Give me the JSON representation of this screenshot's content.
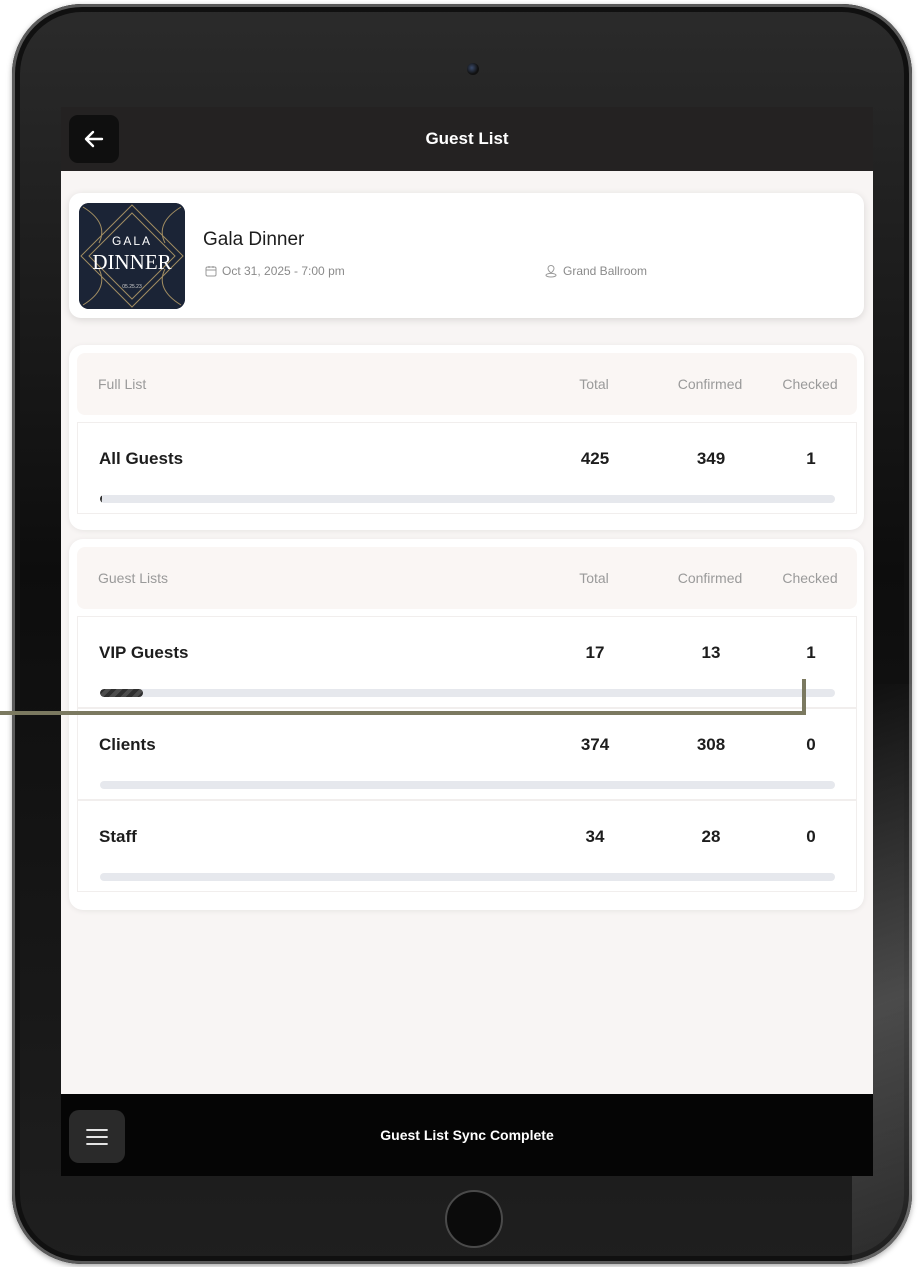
{
  "header": {
    "title": "Guest List"
  },
  "event": {
    "name": "Gala Dinner",
    "date": "Oct 31, 2025 - 7:00 pm",
    "venue": "Grand Ballroom",
    "thumb": {
      "line1": "GALA",
      "line2": "DINNER",
      "line3": "05.25.23"
    }
  },
  "full_list": {
    "header": {
      "name": "Full List",
      "total": "Total",
      "confirmed": "Confirmed",
      "checked": "Checked"
    },
    "rows": [
      {
        "name": "All Guests",
        "total": "425",
        "confirmed": "349",
        "checked": "1",
        "progress": 0.002
      }
    ]
  },
  "guest_lists": {
    "header": {
      "name": "Guest Lists",
      "total": "Total",
      "confirmed": "Confirmed",
      "checked": "Checked"
    },
    "rows": [
      {
        "name": "VIP Guests",
        "total": "17",
        "confirmed": "13",
        "checked": "1",
        "progress": 0.059
      },
      {
        "name": "Clients",
        "total": "374",
        "confirmed": "308",
        "checked": "0",
        "progress": 0
      },
      {
        "name": "Staff",
        "total": "34",
        "confirmed": "28",
        "checked": "0",
        "progress": 0
      }
    ]
  },
  "footer": {
    "status": "Guest List Sync Complete"
  },
  "colors": {
    "topbar": "#242222",
    "bottombar": "#050505",
    "callout": "#7b7960",
    "screen_bg": "#f8f5f4"
  }
}
